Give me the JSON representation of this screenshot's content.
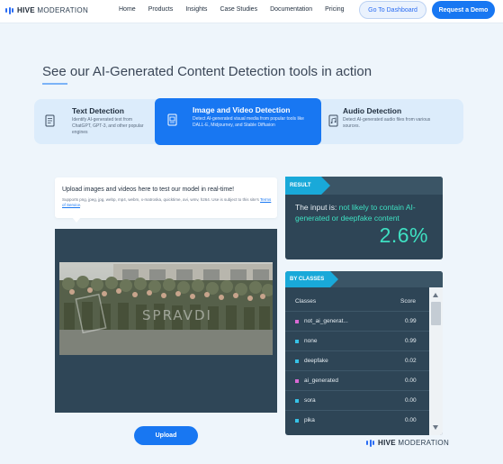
{
  "nav": {
    "logo_bold": "HIVE",
    "logo_rest": " MODERATION",
    "links": [
      "Home",
      "Products",
      "Insights",
      "Case Studies",
      "Documentation",
      "Pricing"
    ],
    "dashboard_label": "Go To Dashboard",
    "demo_label": "Request a Demo"
  },
  "heading": "See our AI-Generated Content Detection tools in action",
  "tabs": [
    {
      "title": "Text Detection",
      "desc": "Identify AI-generated text from ChatGPT, GPT-3, and other popular engines",
      "icon": "document-icon",
      "active": false
    },
    {
      "title": "Image and Video Detection",
      "desc": "Detect AI-generated visual media from popular tools like DALL-E, Midjourney, and Stable Diffusion",
      "icon": "media-icon",
      "active": true
    },
    {
      "title": "Audio Detection",
      "desc": "Detect AI-generated audio files from various sources.",
      "icon": "audio-file-icon",
      "active": false
    }
  ],
  "upload": {
    "title": "Upload images and videos here to test our model in real-time!",
    "supports": "Supports png, jpeg, jpg, webp, mp4, webm, x-matroska, quicktime, avi, wmv, h264. Use is subject to this site's ",
    "terms_link": "Terms of Service",
    "terms_end": ".",
    "watermark": "SPRAVDI",
    "button": "Upload"
  },
  "result": {
    "tab_label": "RESULT",
    "prefix": "The input is: ",
    "verdict": "not likely to contain AI-generated or deepfake content",
    "percent": "2.6%"
  },
  "classes": {
    "tab_label": "BY CLASSES",
    "col_classes": "Classes",
    "col_score": "Score",
    "rows": [
      {
        "name": "not_ai_generat...",
        "score": "0.99",
        "color": "#d96ad4"
      },
      {
        "name": "none",
        "score": "0.99",
        "color": "#36c3e8"
      },
      {
        "name": "deepfake",
        "score": "0.02",
        "color": "#36c3e8"
      },
      {
        "name": "ai_generated",
        "score": "0.00",
        "color": "#d96ad4"
      },
      {
        "name": "sora",
        "score": "0.00",
        "color": "#36c3e8"
      },
      {
        "name": "pika",
        "score": "0.00",
        "color": "#36c3e8"
      }
    ]
  },
  "footer": {
    "logo_bold": "HIVE",
    "logo_rest": " MODERATION"
  },
  "colors": {
    "accent": "#1877f2",
    "result_teal": "#3ee0c2",
    "panel": "#2e4556",
    "tab_cyan": "#19a9d9"
  }
}
